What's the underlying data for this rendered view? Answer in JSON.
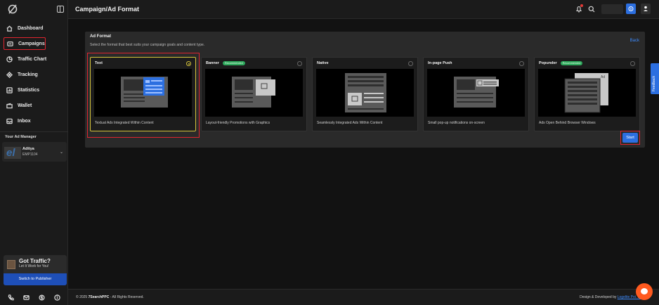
{
  "app": {
    "title": "Campaign/Ad Format"
  },
  "sidebar": {
    "items": [
      {
        "label": "Dashboard",
        "icon": "home-icon"
      },
      {
        "label": "Campaigns",
        "icon": "campaign-icon"
      },
      {
        "label": "Traffic Chart",
        "icon": "chart-icon"
      },
      {
        "label": "Tracking",
        "icon": "target-icon"
      },
      {
        "label": "Statistics",
        "icon": "stats-icon"
      },
      {
        "label": "Wallet",
        "icon": "wallet-icon"
      },
      {
        "label": "Inbox",
        "icon": "inbox-icon"
      }
    ],
    "ad_manager": {
      "title": "Your Ad Manager",
      "avatar": "el",
      "name": "Aditya",
      "id": "EMP1104"
    },
    "promo": {
      "title": "Got Traffic?",
      "subtitle": "Let It Work for You!",
      "button": "Switch to Publisher"
    }
  },
  "main": {
    "heading": "Ad Format",
    "subheading": "Select the format that best suits your campaign goals and content type.",
    "back": "Back",
    "cards": [
      {
        "title": "Text",
        "badge": "",
        "desc": "Textual Ads Integrated Within Content",
        "selected": true
      },
      {
        "title": "Banner",
        "badge": "Recommended",
        "desc": "Layout-friendly Promotions with Graphics",
        "selected": false
      },
      {
        "title": "Native",
        "badge": "",
        "desc": "Seamlessly Integrated Ads Within Content",
        "selected": false
      },
      {
        "title": "In-page Push",
        "badge": "",
        "desc": "Small pop-up notifications on-screen",
        "selected": false
      },
      {
        "title": "Popunder",
        "badge": "Recommended",
        "desc": "Ads Open Behind Browser Windows",
        "selected": false
      }
    ],
    "start": "Start",
    "feedback": "Feedback",
    "popunder_ad_label": "Ad"
  },
  "footer": {
    "copyright_prefix": "© 2025 ",
    "brand": "7SearchPPC",
    "copyright_suffix": " - All Rights Reserved.",
    "credit_prefix": "Design & Developed by ",
    "credit_link": "Logelite Pvt. Ltd."
  },
  "colors": {
    "accent": "#2c6fe0",
    "highlight": "#e0252f",
    "selected": "#d6c43a",
    "badge": "#2ea85c"
  }
}
